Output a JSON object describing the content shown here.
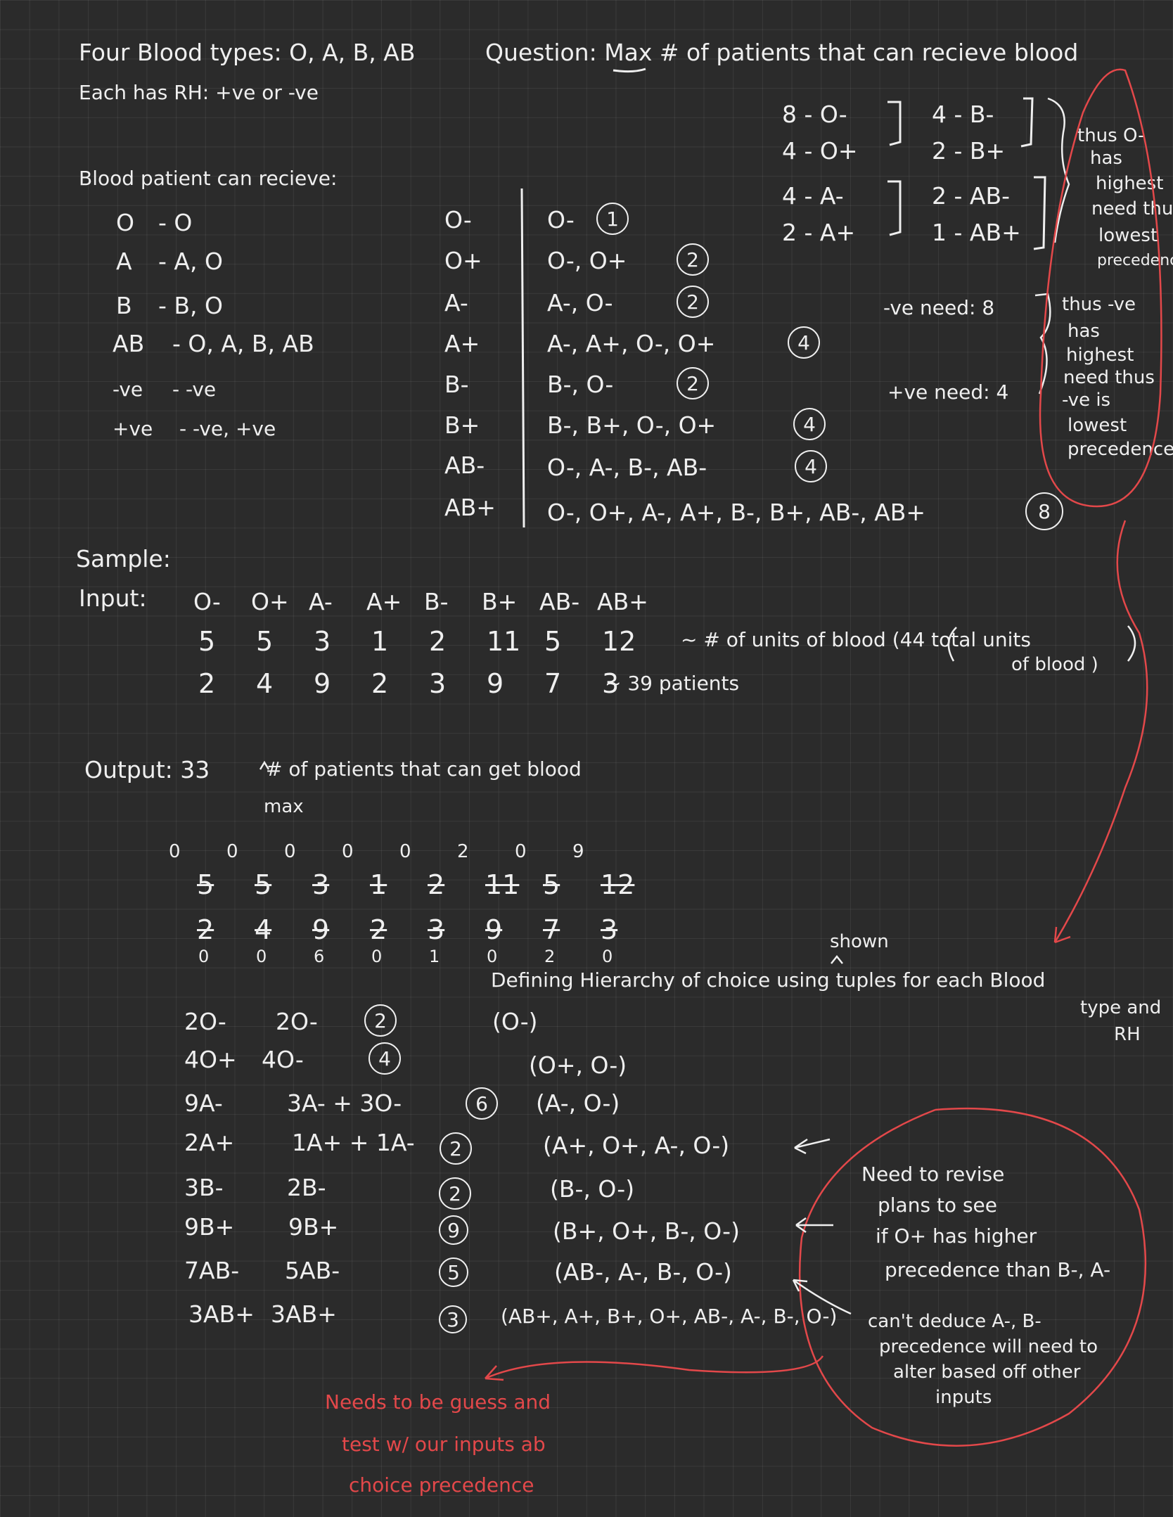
{
  "header": {
    "types_line": "Four Blood types: O, A, B, AB",
    "rh_line": "Each has RH: +ve or -ve",
    "question": "Question: Max # of patients that can recieve blood"
  },
  "compat": {
    "title": "Blood patient can recieve:",
    "rows": [
      {
        "type": "O",
        "gets": "- O"
      },
      {
        "type": "A",
        "gets": "- A, O"
      },
      {
        "type": "B",
        "gets": "- B, O"
      },
      {
        "type": "AB",
        "gets": "- O, A, B, AB"
      },
      {
        "type": "-ve",
        "gets": "- -ve"
      },
      {
        "type": "+ve",
        "gets": "- -ve, +ve"
      }
    ]
  },
  "full_table": {
    "types": [
      "O-",
      "O+",
      "A-",
      "A+",
      "B-",
      "B+",
      "AB-",
      "AB+"
    ],
    "sources": [
      {
        "list": "O-",
        "count": "1"
      },
      {
        "list": "O-, O+",
        "count": "2"
      },
      {
        "list": "A-, O-",
        "count": "2"
      },
      {
        "list": "A-, A+, O-, O+",
        "count": "4"
      },
      {
        "list": "B-, O-",
        "count": "2"
      },
      {
        "list": "B-, B+, O-, O+",
        "count": "4"
      },
      {
        "list": "O-, A-, B-, AB-",
        "count": "4"
      },
      {
        "list": "O-, O+, A-, A+, B-, B+, AB-, AB+",
        "count": "8"
      }
    ]
  },
  "need_counts": {
    "left": [
      "8 - O-",
      "4 - O+",
      "4 - A-",
      "2 - A+"
    ],
    "right": [
      "4 - B-",
      "2 - B+",
      "2 - AB-",
      "1 - AB+"
    ],
    "neg_need": "-ve need: 8",
    "pos_need": "+ve need: 4"
  },
  "notes_red": {
    "o_neg": [
      "thus O-",
      "has",
      "highest",
      "need thus",
      "lowest",
      "precedence"
    ],
    "neg": [
      "thus -ve",
      "has",
      "highest",
      "need thus",
      "-ve is",
      "lowest",
      "precedence"
    ],
    "revise": [
      "Need to revise",
      "plans to see",
      "if O+ has higher",
      "precedence than B-, A-"
    ],
    "deduce": [
      "can't deduce A-, B-",
      "precedence will need to",
      "alter based off other",
      "inputs"
    ],
    "guess": [
      "Needs to be guess and",
      "test w/ our inputs ab",
      "choice precedence"
    ]
  },
  "sample": {
    "label": "Sample:",
    "input_label": "Input:",
    "headers": [
      "O-",
      "O+",
      "A-",
      "A+",
      "B-",
      "B+",
      "AB-",
      "AB+"
    ],
    "units": [
      "5",
      "5",
      "3",
      "1",
      "2",
      "11",
      "5",
      "12"
    ],
    "patients": [
      "2",
      "4",
      "9",
      "2",
      "3",
      "9",
      "7",
      "3"
    ],
    "units_note": "~ # of units of blood (44 total units",
    "units_note2": "of blood )",
    "patients_note": "~ 39 patients",
    "output": "Output: 33",
    "output_note": "# of patients that can get blood",
    "max_note": "max"
  },
  "scratch": {
    "row1_top": [
      "0",
      "0",
      "0",
      "0",
      "0",
      "2",
      "0",
      "9"
    ],
    "row1": [
      "5",
      "5",
      "3",
      "1",
      "2",
      "11",
      "5",
      "12"
    ],
    "row2": [
      "2",
      "4",
      "9",
      "2",
      "3",
      "9",
      "7",
      "3"
    ],
    "row2_bottom": [
      "0",
      "0",
      "6",
      "0",
      "1",
      "0",
      "2",
      "0"
    ]
  },
  "allocation": [
    {
      "left": "2O-",
      "right": "2O-",
      "count": "2"
    },
    {
      "left": "4O+",
      "right": "4O-",
      "count": "4"
    },
    {
      "left": "9A-",
      "right": "3A- + 3O-",
      "count": "6"
    },
    {
      "left": "2A+",
      "right": "1A+ + 1A-",
      "count": "2"
    },
    {
      "left": "3B-",
      "right": "2B-",
      "count": "2"
    },
    {
      "left": "9B+",
      "right": "9B+",
      "count": "9"
    },
    {
      "left": "7AB-",
      "right": "5AB-",
      "count": "5"
    },
    {
      "left": "3AB+",
      "right": "3AB+",
      "count": "3"
    }
  ],
  "hierarchy": {
    "title": "Defining Hierarchy of choice using tuples for each Blood",
    "title2": "type and",
    "title3": "RH",
    "shown": "shown",
    "tuples": [
      "(O-)",
      "(O+, O-)",
      "(A-, O-)",
      "(A+, O+, A-, O-)",
      "(B-, O-)",
      "(B+, O+, B-, O-)",
      "(AB-, A-, B-, O-)",
      "(AB+, A+, B+, O+, AB-, A-, B-, O-)"
    ]
  }
}
